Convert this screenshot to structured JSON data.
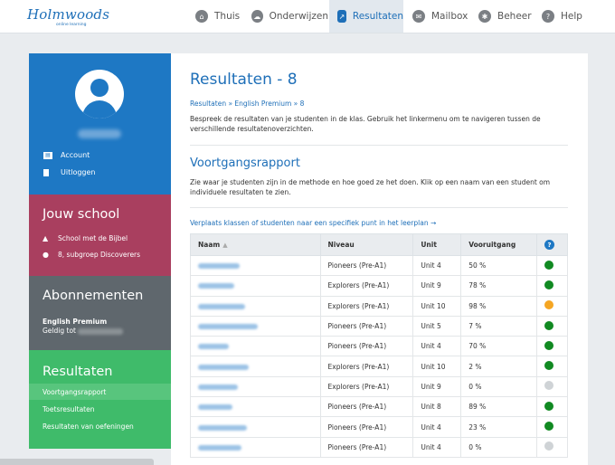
{
  "logo": {
    "word": "Holmwoods",
    "tagline": "online learning"
  },
  "nav": [
    {
      "label": "Thuis",
      "icon": "home-icon",
      "glyph": "⌂"
    },
    {
      "label": "Onderwijzen",
      "icon": "cloud-icon",
      "glyph": "☁"
    },
    {
      "label": "Resultaten",
      "icon": "chart-icon",
      "glyph": "↗"
    },
    {
      "label": "Mailbox",
      "icon": "mail-icon",
      "glyph": "✉"
    },
    {
      "label": "Beheer",
      "icon": "tools-icon",
      "glyph": "✱"
    },
    {
      "label": "Help",
      "icon": "help-icon",
      "glyph": "?"
    }
  ],
  "sidebar": {
    "profile": {
      "account": "Account",
      "logout": "Uitloggen"
    },
    "school": {
      "heading": "Jouw school",
      "name": "School met de Bijbel",
      "group": "8, subgroep Discoverers"
    },
    "subscription": {
      "heading": "Abonnementen",
      "plan": "English Premium",
      "valid_prefix": "Geldig tot"
    },
    "results": {
      "heading": "Resultaten",
      "links": [
        "Voortgangsrapport",
        "Toetsresultaten",
        "Resultaten van oefeningen"
      ]
    }
  },
  "main": {
    "title": "Resultaten - 8",
    "breadcrumb": "Resultaten » English Premium » 8",
    "intro": "Bespreek de resultaten van je studenten in de klas. Gebruik het linkermenu om te navigeren tussen de verschillende resultatenoverzichten.",
    "section_title": "Voortgangsrapport",
    "section_desc": "Zie waar je studenten zijn in de methode en hoe goed ze het doen. Klik op een naam van een student om individuele resultaten te zien.",
    "plan_link": "Verplaats klassen of studenten naar een specifiek punt in het leerplan →"
  },
  "table": {
    "headers": {
      "name": "Naam",
      "level": "Niveau",
      "unit": "Unit",
      "progress": "Vooruitgang",
      "help": "?"
    },
    "colors": {
      "green": "#118a22",
      "orange": "#f5a623",
      "grey": "#cfd3d6"
    },
    "rows": [
      {
        "level": "Pioneers (Pre-A1)",
        "unit": "Unit 4",
        "progress": "50 %",
        "status": "green"
      },
      {
        "level": "Explorers (Pre-A1)",
        "unit": "Unit 9",
        "progress": "78 %",
        "status": "green"
      },
      {
        "level": "Explorers (Pre-A1)",
        "unit": "Unit 10",
        "progress": "98 %",
        "status": "orange"
      },
      {
        "level": "Pioneers (Pre-A1)",
        "unit": "Unit 5",
        "progress": "7 %",
        "status": "green"
      },
      {
        "level": "Pioneers (Pre-A1)",
        "unit": "Unit 4",
        "progress": "70 %",
        "status": "green"
      },
      {
        "level": "Explorers (Pre-A1)",
        "unit": "Unit 10",
        "progress": "2 %",
        "status": "green"
      },
      {
        "level": "Explorers (Pre-A1)",
        "unit": "Unit 9",
        "progress": "0 %",
        "status": "grey"
      },
      {
        "level": "Pioneers (Pre-A1)",
        "unit": "Unit 8",
        "progress": "89 %",
        "status": "green"
      },
      {
        "level": "Pioneers (Pre-A1)",
        "unit": "Unit 4",
        "progress": "23 %",
        "status": "green"
      },
      {
        "level": "Pioneers (Pre-A1)",
        "unit": "Unit 4",
        "progress": "0 %",
        "status": "grey"
      }
    ]
  }
}
